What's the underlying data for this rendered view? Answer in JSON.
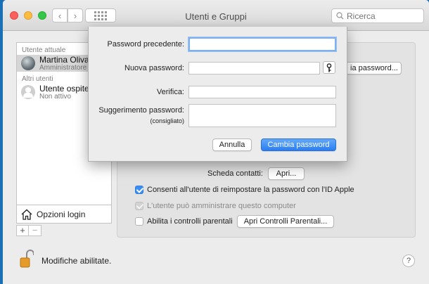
{
  "window": {
    "title": "Utenti e Gruppi"
  },
  "search": {
    "placeholder": "Ricerca"
  },
  "sidebar": {
    "current_header": "Utente attuale",
    "current_user": {
      "name": "Martina Oliva",
      "role": "Amministratore"
    },
    "others_header": "Altri utenti",
    "other_users": [
      {
        "name": "Utente ospite",
        "role": "Non attivo"
      }
    ],
    "login_options": "Opzioni login",
    "add_symbol": "+",
    "remove_symbol": "−"
  },
  "panel": {
    "change_password_partial": "ia password...",
    "contacts_label": "Scheda contatti:",
    "open_button": "Apri...",
    "allow_reset_label": "Consenti all'utente di reimpostare la password con l'ID Apple",
    "allow_reset_checked": true,
    "admin_label": "L'utente può amministrare questo computer",
    "admin_checked": true,
    "parental_label": "Abilita i controlli parentali",
    "parental_checked": false,
    "parental_button": "Apri Controlli Parentali..."
  },
  "footer": {
    "lock_text": "Modifiche abilitate.",
    "help": "?"
  },
  "sheet": {
    "old_password_label": "Password precedente:",
    "new_password_label": "Nuova password:",
    "verify_label": "Verifica:",
    "hint_label": "Suggerimento password:",
    "hint_sublabel": "(consigliato)",
    "old_password_value": "",
    "new_password_value": "",
    "verify_value": "",
    "hint_value": "",
    "cancel_button": "Annulla",
    "confirm_button": "Cambia password"
  },
  "colors": {
    "accent": "#2a7df0",
    "checkbox_on": "#3b8ef3"
  }
}
